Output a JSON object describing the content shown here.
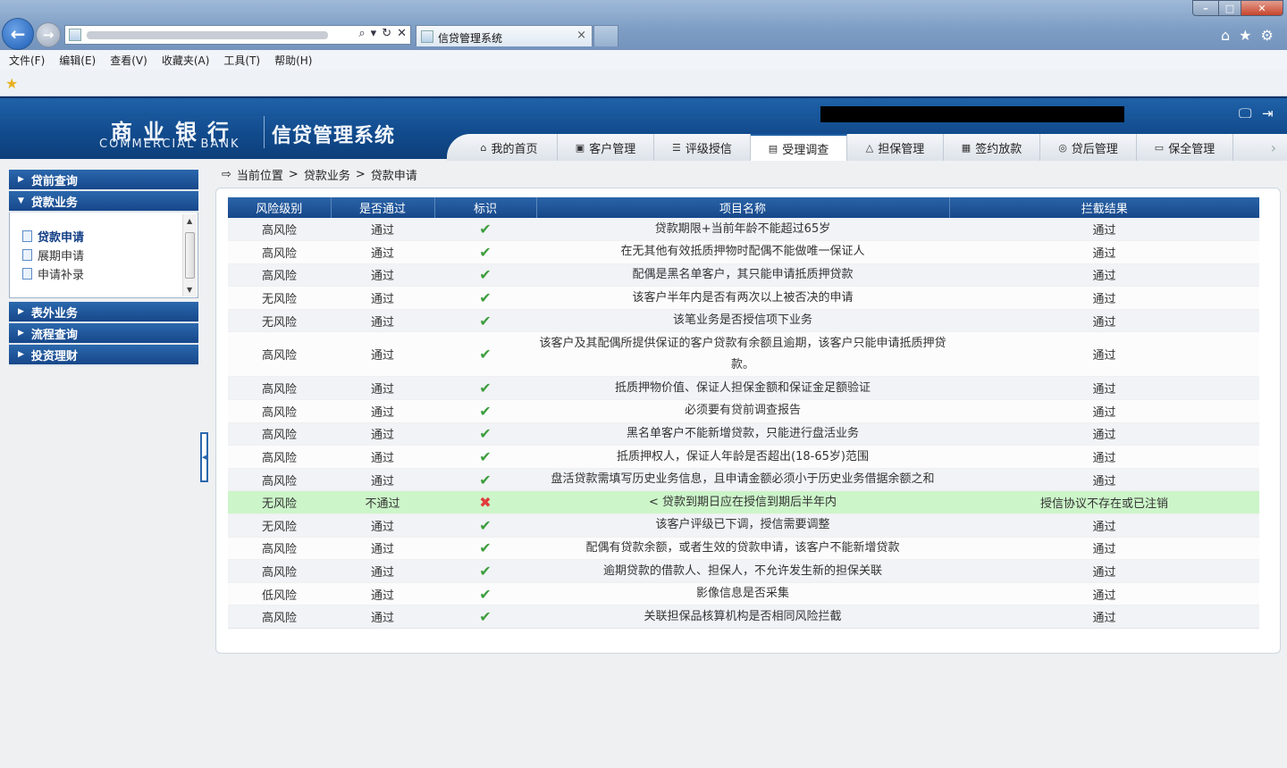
{
  "browser": {
    "tab_title": "信贷管理系统",
    "tab_close": "×",
    "menu": [
      "文件(F)",
      "编辑(E)",
      "查看(V)",
      "收藏夹(A)",
      "工具(T)",
      "帮助(H)"
    ]
  },
  "header": {
    "logo_cn": "商业银行",
    "logo_en": "COMMERCIAL BANK",
    "system_title": "信贷管理系统",
    "nav_tabs": [
      {
        "label": "我的首页",
        "icon": "home-icon"
      },
      {
        "label": "客户管理",
        "icon": "user-card-icon"
      },
      {
        "label": "评级授信",
        "icon": "list-icon"
      },
      {
        "label": "受理调查",
        "icon": "document-icon",
        "active": true
      },
      {
        "label": "担保管理",
        "icon": "warning-triangle-icon"
      },
      {
        "label": "签约放款",
        "icon": "calculator-icon"
      },
      {
        "label": "贷后管理",
        "icon": "database-icon"
      },
      {
        "label": "保全管理",
        "icon": "folder-icon"
      }
    ]
  },
  "sidebar": {
    "groups": [
      {
        "label": "贷前查询",
        "expanded": false
      },
      {
        "label": "贷款业务",
        "expanded": true,
        "items": [
          {
            "label": "贷款申请",
            "active": true
          },
          {
            "label": "展期申请"
          },
          {
            "label": "申请补录"
          }
        ]
      },
      {
        "label": "表外业务",
        "expanded": false
      },
      {
        "label": "流程查询",
        "expanded": false
      },
      {
        "label": "投资理财",
        "expanded": false
      }
    ]
  },
  "breadcrumb": {
    "prefix": "当前位置",
    "sep": ">",
    "level1": "贷款业务",
    "level2": "贷款申请"
  },
  "table": {
    "headers": [
      "风险级别",
      "是否通过",
      "标识",
      "项目名称",
      "拦截结果"
    ],
    "rows": [
      {
        "risk": "高风险",
        "pass": "通过",
        "ok": true,
        "name": "贷款期限+当前年龄不能超过65岁",
        "result": "通过"
      },
      {
        "risk": "高风险",
        "pass": "通过",
        "ok": true,
        "name": "在无其他有效抵质押物时配偶不能做唯一保证人",
        "result": "通过"
      },
      {
        "risk": "高风险",
        "pass": "通过",
        "ok": true,
        "name": "配偶是黑名单客户，其只能申请抵质押贷款",
        "result": "通过"
      },
      {
        "risk": "无风险",
        "pass": "通过",
        "ok": true,
        "name": "该客户半年内是否有两次以上被否决的申请",
        "result": "通过"
      },
      {
        "risk": "无风险",
        "pass": "通过",
        "ok": true,
        "name": "该笔业务是否授信项下业务",
        "result": "通过"
      },
      {
        "risk": "高风险",
        "pass": "通过",
        "ok": true,
        "name": "该客户及其配偶所提供保证的客户贷款有余额且逾期，该客户只能申请抵质押贷款。",
        "result": "通过",
        "tall": true
      },
      {
        "risk": "高风险",
        "pass": "通过",
        "ok": true,
        "name": "抵质押物价值、保证人担保金额和保证金足额验证",
        "result": "通过"
      },
      {
        "risk": "高风险",
        "pass": "通过",
        "ok": true,
        "name": "必须要有贷前调查报告",
        "result": "通过"
      },
      {
        "risk": "高风险",
        "pass": "通过",
        "ok": true,
        "name": "黑名单客户不能新增贷款，只能进行盘活业务",
        "result": "通过"
      },
      {
        "risk": "高风险",
        "pass": "通过",
        "ok": true,
        "name": "抵质押权人，保证人年龄是否超出(18-65岁)范围",
        "result": "通过"
      },
      {
        "risk": "高风险",
        "pass": "通过",
        "ok": true,
        "name": "盘活贷款需填写历史业务信息，且申请金额必须小于历史业务借据余额之和",
        "result": "通过"
      },
      {
        "risk": "无风险",
        "pass": "不通过",
        "ok": false,
        "name": "< 贷款到期日应在授信到期后半年内",
        "result": "授信协议不存在或已注销",
        "highlight": true
      },
      {
        "risk": "无风险",
        "pass": "通过",
        "ok": true,
        "name": "该客户评级已下调，授信需要调整",
        "result": "通过"
      },
      {
        "risk": "高风险",
        "pass": "通过",
        "ok": true,
        "name": "配偶有贷款余额，或者生效的贷款申请，该客户不能新增贷款",
        "result": "通过"
      },
      {
        "risk": "高风险",
        "pass": "通过",
        "ok": true,
        "name": "逾期贷款的借款人、担保人，不允许发生新的担保关联",
        "result": "通过"
      },
      {
        "risk": "低风险",
        "pass": "通过",
        "ok": true,
        "name": "影像信息是否采集",
        "result": "通过"
      },
      {
        "risk": "高风险",
        "pass": "通过",
        "ok": true,
        "name": "关联担保品核算机构是否相同风险拦截",
        "result": "通过"
      }
    ]
  },
  "colors": {
    "header_blue": "#17478a",
    "ok_green": "#3d9d3d",
    "fail_red": "#e23b3b",
    "highlight_row": "#ccf5c9"
  }
}
